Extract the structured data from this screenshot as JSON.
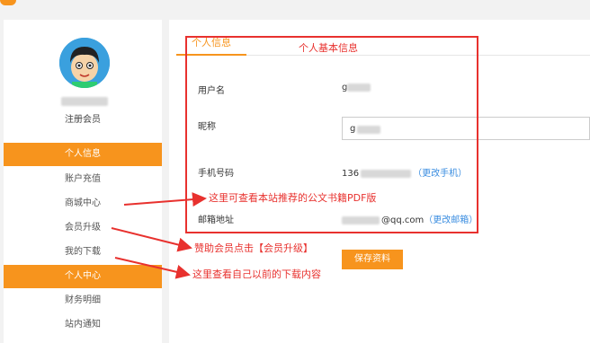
{
  "sidebar": {
    "username_hint": "g",
    "role": "注册会员",
    "items": [
      {
        "label": "个人信息",
        "active": true
      },
      {
        "label": "账户充值",
        "active": false
      },
      {
        "label": "商城中心",
        "active": false
      },
      {
        "label": "会员升级",
        "active": false
      },
      {
        "label": "我的下载",
        "active": false
      },
      {
        "label": "个人中心",
        "active": true
      },
      {
        "label": "财务明细",
        "active": false
      },
      {
        "label": "站内通知",
        "active": false
      }
    ]
  },
  "main": {
    "tab_label": "个人信息",
    "fields": {
      "username_label": "用户名",
      "username_value": "g",
      "nickname_label": "昵称",
      "nickname_value": "g",
      "phone_label": "手机号码",
      "phone_prefix": "136",
      "phone_change_link": "（更改手机）",
      "email_label": "邮箱地址",
      "email_suffix": "@qq.com",
      "email_change_link": "（更改邮箱）"
    },
    "save_button": "保存资料"
  },
  "annotations": {
    "box_title": "个人基本信息",
    "mall_note": "这里可查看本站推荐的公文书籍PDF版",
    "upgrade_note": "赞助会员点击【会员升级】",
    "download_note": "这里查看自己以前的下载内容"
  },
  "colors": {
    "accent": "#f7941d",
    "annotation": "#e8312e",
    "link": "#3a8de0"
  }
}
